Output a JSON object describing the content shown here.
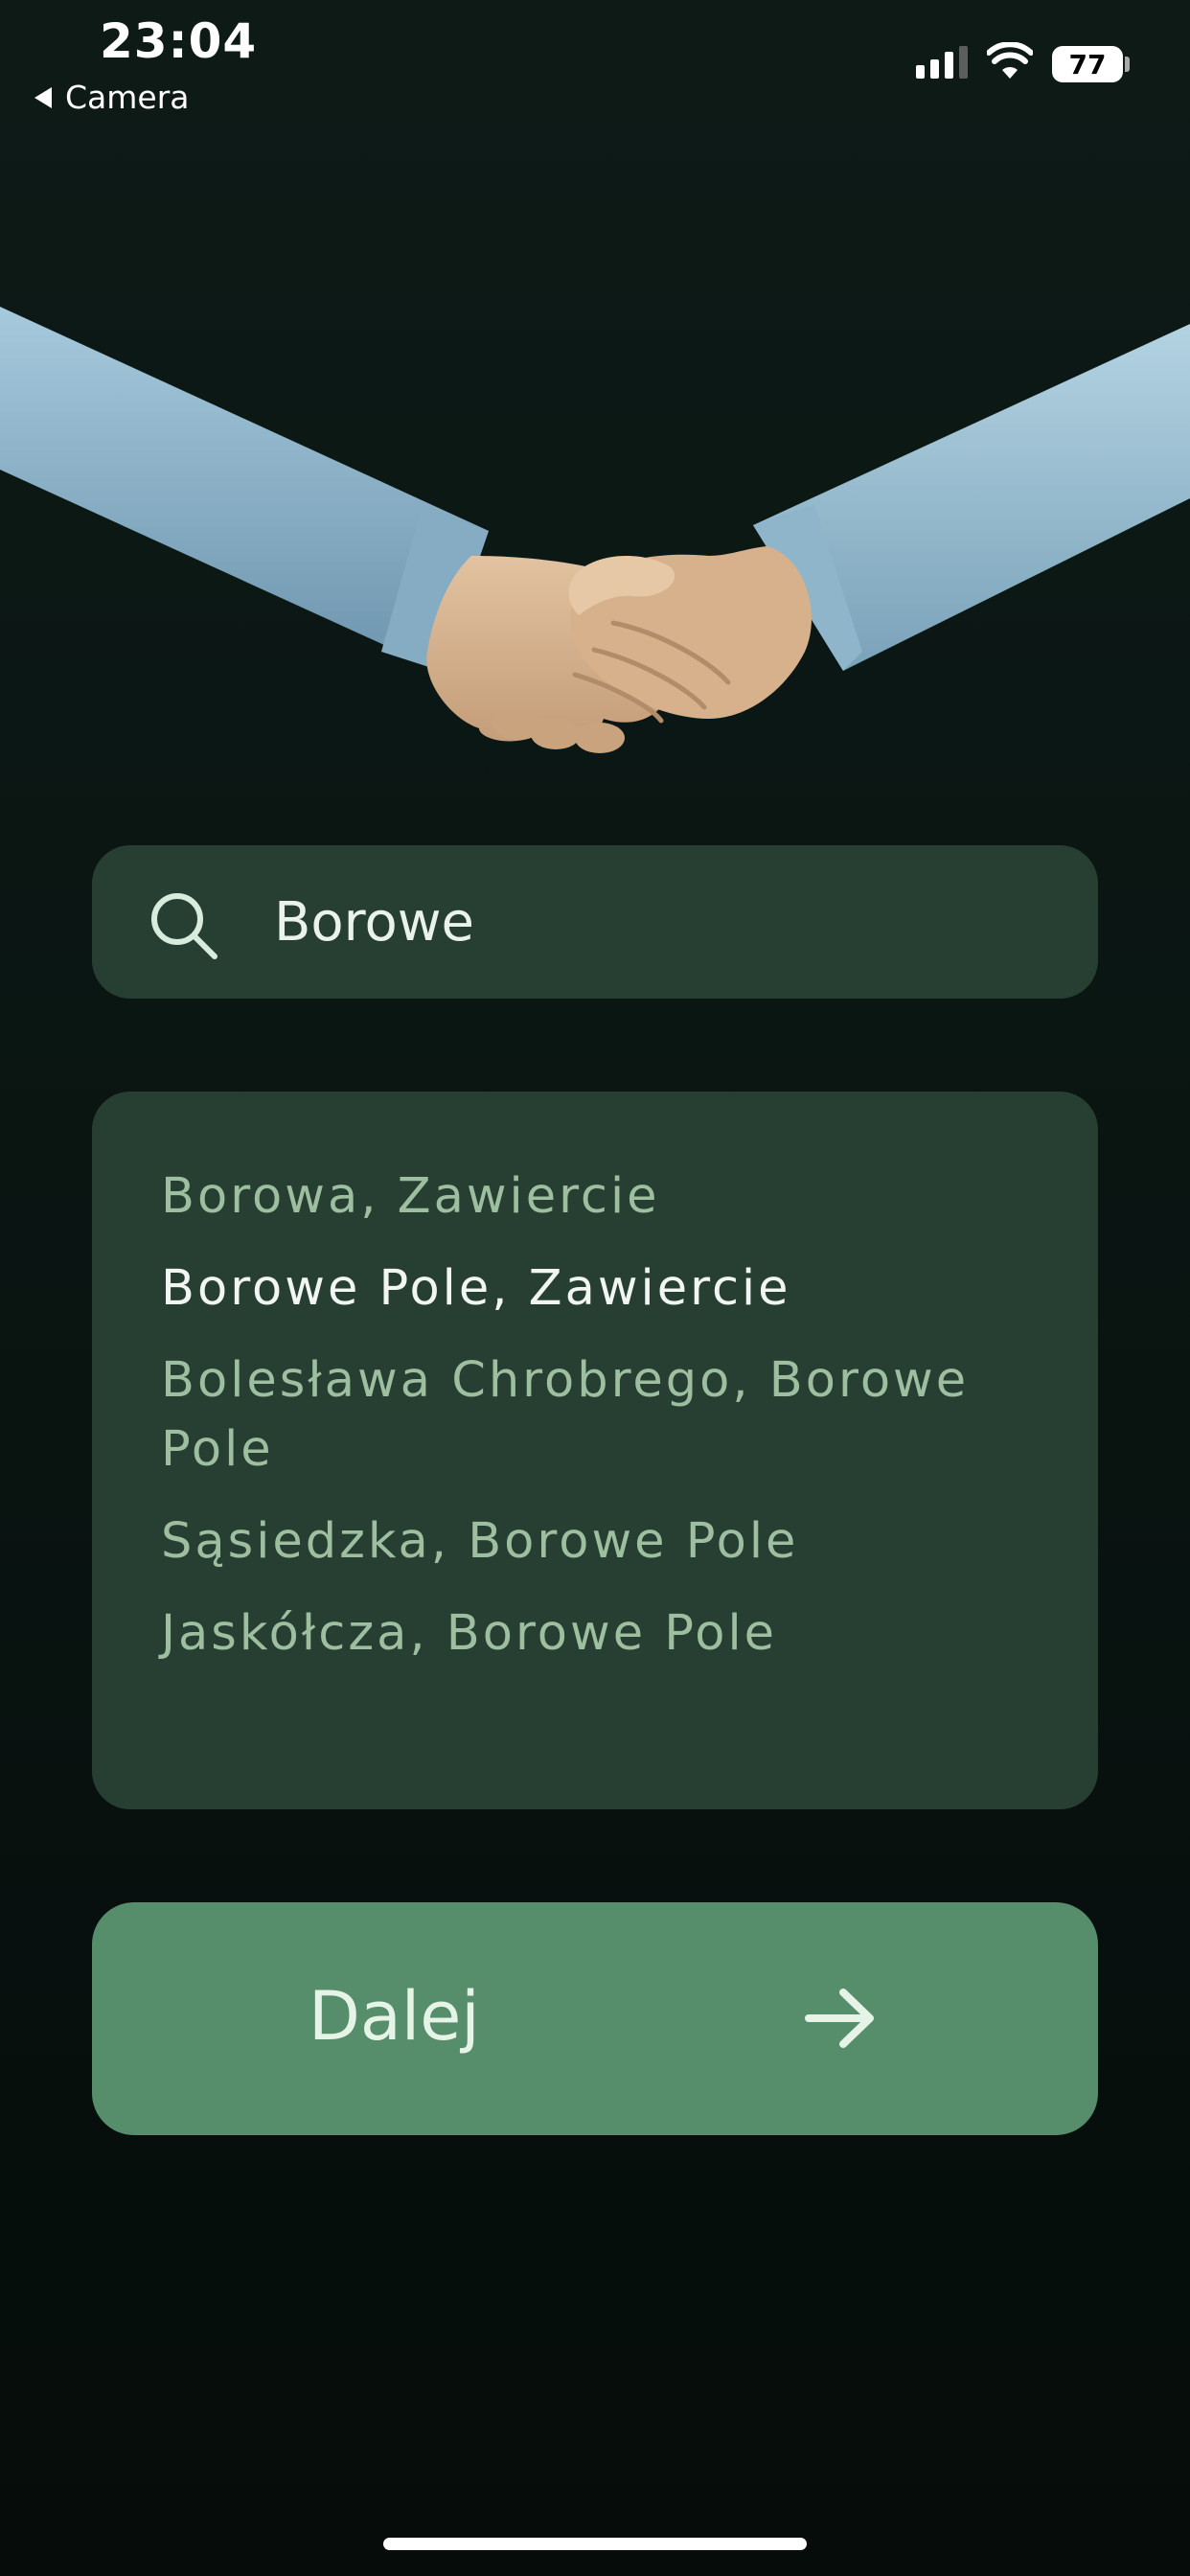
{
  "status_bar": {
    "time": "23:04",
    "back_label": "Camera",
    "battery_level": "77",
    "signal_bars_active": 3,
    "signal_bars_total": 4
  },
  "illustration": {
    "icon": "handshake-icon"
  },
  "search": {
    "icon": "search-icon",
    "value": "Borowe"
  },
  "suggestions": [
    {
      "label": "Borowa, Zawiercie",
      "highlighted": false
    },
    {
      "label": "Borowe Pole, Zawiercie",
      "highlighted": true
    },
    {
      "label": "Bolesława Chrobrego, Borowe Pole",
      "highlighted": false
    },
    {
      "label": "Sąsiedzka, Borowe Pole",
      "highlighted": false
    },
    {
      "label": "Jaskółcza, Borowe Pole",
      "highlighted": false
    }
  ],
  "next_button": {
    "label": "Dalej",
    "icon": "arrow-right-icon"
  },
  "colors": {
    "background": "#0b1613",
    "card": "#273f33",
    "button": "#568e6b",
    "suggestion_text": "#9dbf9f",
    "suggestion_highlight": "#f1f6f2",
    "sleeve": "#92b8cf",
    "skin": "#d8b491"
  }
}
